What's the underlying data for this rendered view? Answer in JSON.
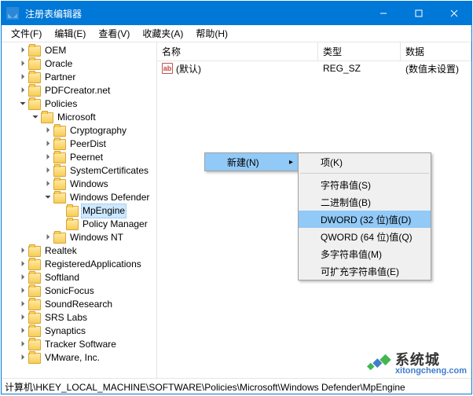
{
  "titlebar": {
    "title": "注册表编辑器"
  },
  "menubar": {
    "file": "文件(F)",
    "edit": "编辑(E)",
    "view": "查看(V)",
    "favorites": "收藏夹(A)",
    "help": "帮助(H)"
  },
  "tree": {
    "nodes": [
      {
        "depth": 1,
        "expand": "closed",
        "label": "OEM"
      },
      {
        "depth": 1,
        "expand": "closed",
        "label": "Oracle"
      },
      {
        "depth": 1,
        "expand": "closed",
        "label": "Partner"
      },
      {
        "depth": 1,
        "expand": "closed",
        "label": "PDFCreator.net"
      },
      {
        "depth": 1,
        "expand": "open",
        "label": "Policies"
      },
      {
        "depth": 2,
        "expand": "open",
        "label": "Microsoft"
      },
      {
        "depth": 3,
        "expand": "closed",
        "label": "Cryptography"
      },
      {
        "depth": 3,
        "expand": "closed",
        "label": "PeerDist"
      },
      {
        "depth": 3,
        "expand": "closed",
        "label": "Peernet"
      },
      {
        "depth": 3,
        "expand": "closed",
        "label": "SystemCertificates"
      },
      {
        "depth": 3,
        "expand": "closed",
        "label": "Windows"
      },
      {
        "depth": 3,
        "expand": "open",
        "label": "Windows Defender"
      },
      {
        "depth": 4,
        "expand": "none",
        "label": "MpEngine",
        "selected": true
      },
      {
        "depth": 4,
        "expand": "none",
        "label": "Policy Manager"
      },
      {
        "depth": 3,
        "expand": "closed",
        "label": "Windows NT"
      },
      {
        "depth": 1,
        "expand": "closed",
        "label": "Realtek"
      },
      {
        "depth": 1,
        "expand": "closed",
        "label": "RegisteredApplications"
      },
      {
        "depth": 1,
        "expand": "closed",
        "label": "Softland"
      },
      {
        "depth": 1,
        "expand": "closed",
        "label": "SonicFocus"
      },
      {
        "depth": 1,
        "expand": "closed",
        "label": "SoundResearch"
      },
      {
        "depth": 1,
        "expand": "closed",
        "label": "SRS Labs"
      },
      {
        "depth": 1,
        "expand": "closed",
        "label": "Synaptics"
      },
      {
        "depth": 1,
        "expand": "closed",
        "label": "Tracker Software"
      },
      {
        "depth": 1,
        "expand": "closed",
        "label": "VMware, Inc."
      }
    ]
  },
  "list": {
    "cols": {
      "name": "名称",
      "type": "类型",
      "data": "数据"
    },
    "rows": [
      {
        "name": "(默认)",
        "type": "REG_SZ",
        "data": "(数值未设置)"
      }
    ]
  },
  "context": {
    "new": "新建(N)",
    "submenu": {
      "key": "项(K)",
      "string": "字符串值(S)",
      "binary": "二进制值(B)",
      "dword": "DWORD (32 位)值(D)",
      "qword": "QWORD (64 位)值(Q)",
      "multi": "多字符串值(M)",
      "expand": "可扩充字符串值(E)"
    }
  },
  "statusbar": {
    "path": "计算机\\HKEY_LOCAL_MACHINE\\SOFTWARE\\Policies\\Microsoft\\Windows Defender\\MpEngine"
  },
  "watermark": {
    "cn": "系统城",
    "en": "xitongcheng.com"
  }
}
